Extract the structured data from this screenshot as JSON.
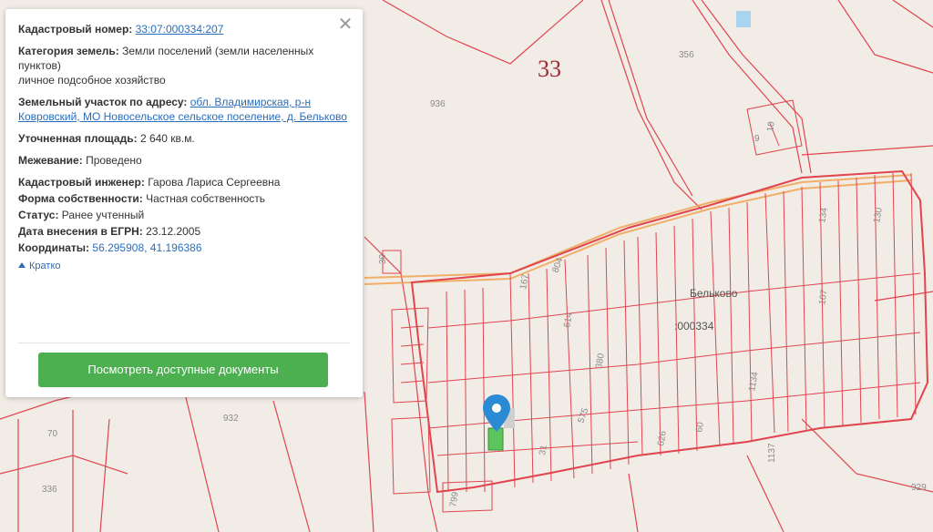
{
  "panel": {
    "cadastral_number": {
      "label": "Кадастровый номер:",
      "value": "33:07:000334:207"
    },
    "land_category": {
      "label": "Категория земель:",
      "value": "Земли поселений (земли населенных пунктов)",
      "extra": "личное подсобное хозяйство"
    },
    "address": {
      "label": "Земельный участок по адресу:",
      "value": "обл. Владимирская, р-н Ковровский, МО Новосельское сельское поселение, д. Бельково"
    },
    "area": {
      "label": "Уточненная площадь:",
      "value": "2 640 кв.м."
    },
    "survey": {
      "label": "Межевание:",
      "value": "Проведено"
    },
    "engineer": {
      "label": "Кадастровый инженер:",
      "value": "Гарова Лариса Сергеевна"
    },
    "ownership": {
      "label": "Форма собственности:",
      "value": "Частная собственность"
    },
    "status": {
      "label": "Статус:",
      "value": "Ранее учтенный"
    },
    "registry_date": {
      "label": "Дата внесения в ЕГРН:",
      "value": "23.12.2005"
    },
    "coordinates": {
      "label": "Координаты:",
      "value": "56.295908, 41.196386"
    },
    "brief_link": "Кратко",
    "button_label": "Посмотреть доступные документы",
    "close_symbol": "✕"
  },
  "map": {
    "big_label": "33",
    "village_name": "Бельково",
    "block_code": ":000334",
    "parcel_labels": [
      "356",
      "936",
      "30",
      "804",
      "167",
      "614",
      "380",
      "107",
      "134",
      "130",
      "10",
      "9",
      "1134",
      "1137",
      "929",
      "932",
      "70",
      "336",
      "799",
      "31",
      "575",
      "626",
      "60"
    ],
    "colors": {
      "parcel_line": "#e0454e",
      "road": "#f0a04a",
      "background": "#f1ece6",
      "marker": "#2a8ad4",
      "selected_parcel": "#5cc65c"
    }
  }
}
